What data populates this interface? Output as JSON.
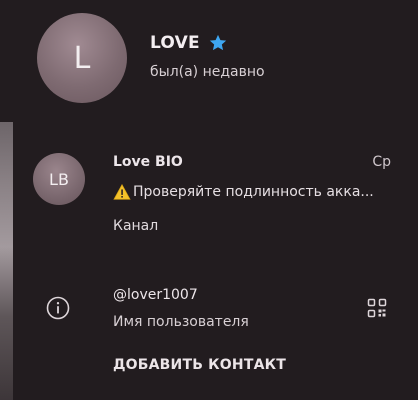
{
  "profile": {
    "avatar_letter": "L",
    "name": "LOVE",
    "status": "был(а) недавно",
    "badge_icon": "star-icon",
    "badge_color": "#3ea6f0"
  },
  "channel": {
    "avatar_initials": "LB",
    "title": "Love BIO",
    "time": "Ср",
    "message": "Проверяйте подлинность акка...",
    "message_icon": "warning-icon",
    "type_label": "Канал"
  },
  "username_section": {
    "icon": "info-icon",
    "username": "@lover1007",
    "caption": "Имя пользователя",
    "qr_icon": "qr-code-icon"
  },
  "actions": {
    "add_contact": "ДОБАВИТЬ КОНТАКТ"
  },
  "colors": {
    "background": "#221c1f",
    "avatar": "#7f6b72",
    "text": "#ece5e8",
    "accent": "#3ea6f0",
    "warning": "#f3c12a"
  }
}
